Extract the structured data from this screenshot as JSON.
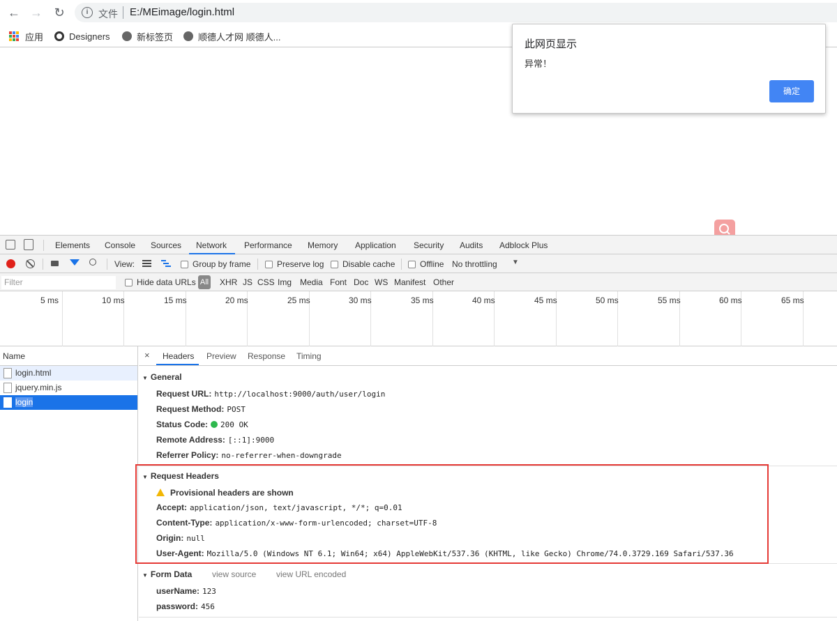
{
  "browser": {
    "scheme_label": "文件",
    "url": "E:/MEimage/login.html",
    "bookmarks": [
      {
        "label": "应用",
        "icon": "apps-grid-icon"
      },
      {
        "label": "Designers",
        "icon": "designers-icon"
      },
      {
        "label": "新标签页",
        "icon": "globe-icon"
      },
      {
        "label": "顺德人才网 顺德人...",
        "icon": "globe-icon"
      }
    ]
  },
  "dialog": {
    "title": "此网页显示",
    "message": "异常！",
    "ok_label": "确定"
  },
  "devtools": {
    "tabs": [
      "Elements",
      "Console",
      "Sources",
      "Network",
      "Performance",
      "Memory",
      "Application",
      "Security",
      "Audits",
      "Adblock Plus"
    ],
    "active_tab": "Network",
    "toolbar": {
      "view_label": "View:",
      "group_by_frame": "Group by frame",
      "preserve_log": "Preserve log",
      "disable_cache": "Disable cache",
      "offline": "Offline",
      "throttling": "No throttling"
    },
    "filterbar": {
      "filter_placeholder": "Filter",
      "hide_data_urls": "Hide data URLs",
      "all": "All",
      "types": [
        "XHR",
        "JS",
        "CSS",
        "Img",
        "Media",
        "Font",
        "Doc",
        "WS",
        "Manifest",
        "Other"
      ]
    },
    "timeline_ticks": [
      "5 ms",
      "10 ms",
      "15 ms",
      "20 ms",
      "25 ms",
      "30 ms",
      "35 ms",
      "40 ms",
      "45 ms",
      "50 ms",
      "55 ms",
      "60 ms",
      "65 ms"
    ],
    "name_header": "Name",
    "requests": [
      "login.html",
      "jquery.min.js",
      "login"
    ],
    "detail_tabs": [
      "Headers",
      "Preview",
      "Response",
      "Timing"
    ],
    "general": {
      "title": "General",
      "request_url_k": "Request URL:",
      "request_url_v": "http://localhost:9000/auth/user/login",
      "method_k": "Request Method:",
      "method_v": "POST",
      "status_k": "Status Code:",
      "status_v": "200 OK",
      "remote_k": "Remote Address:",
      "remote_v": "[::1]:9000",
      "referrer_k": "Referrer Policy:",
      "referrer_v": "no-referrer-when-downgrade"
    },
    "request_headers": {
      "title": "Request Headers",
      "warning": "Provisional headers are shown",
      "accept_k": "Accept:",
      "accept_v": "application/json, text/javascript, */*; q=0.01",
      "ctype_k": "Content-Type:",
      "ctype_v": "application/x-www-form-urlencoded; charset=UTF-8",
      "origin_k": "Origin:",
      "origin_v": "null",
      "ua_k": "User-Agent:",
      "ua_v": "Mozilla/5.0 (Windows NT 6.1; Win64; x64) AppleWebKit/537.36 (KHTML, like Gecko) Chrome/74.0.3729.169 Safari/537.36"
    },
    "form_data": {
      "title": "Form Data",
      "view_source": "view source",
      "view_url_encoded": "view URL encoded",
      "username_k": "userName:",
      "username_v": "123",
      "password_k": "password:",
      "password_v": "456"
    }
  },
  "colors": {
    "accent": "#1a73e8",
    "dialog_button": "#4285f4",
    "highlight_box": "#e53935",
    "status_ok": "#2db84d",
    "record": "#e0211a"
  }
}
